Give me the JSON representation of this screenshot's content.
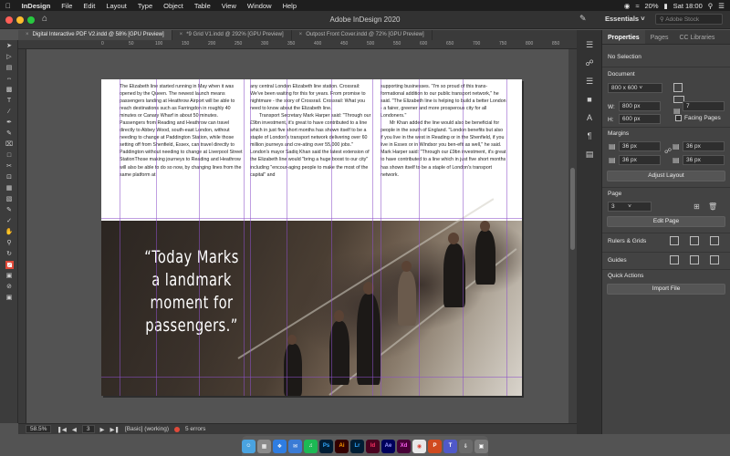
{
  "menubar": {
    "app_name": "InDesign",
    "items": [
      "File",
      "Edit",
      "Layout",
      "Type",
      "Object",
      "Table",
      "View",
      "Window",
      "Help"
    ],
    "battery": "20%",
    "clock": "Sat 18:00"
  },
  "window": {
    "title": "Adobe InDesign 2020",
    "workspace": "Essentials",
    "search_placeholder": "Adobe Stock"
  },
  "tabs": [
    {
      "label": "Digital Interactive PDF V2.indd @ 58% [GPU Preview]"
    },
    {
      "label": "*9 Grid V1.indd @ 292% [GPU Preview]"
    },
    {
      "label": "Outpost Front Cover.indd @ 72% [GPU Preview]"
    }
  ],
  "ruler": {
    "labels": [
      "0",
      "50",
      "100",
      "150",
      "200",
      "250",
      "300",
      "350",
      "400",
      "450",
      "500",
      "550",
      "600",
      "650",
      "700",
      "750",
      "800",
      "850"
    ]
  },
  "document": {
    "col1": "The Elizabeth line started running in May when it was opened by the Queen. The newest launch means passengers landing at Heathrow Airport will be able to reach destinations such as Farringdon in roughly 40 minutes or Canary Wharf in about 50 minutes. Passengers from Reading and Heathrow can travel directly to Abbey Wood, south-east London, without needing to change at Paddington Station, while those setting off from Shenfield, Essex, can travel directly to Paddington without needing to change at Liverpool Street StationThose making journeys to Reading and Heathrow will also be able to do so now, by changing lines from the same platform at",
    "col2_p1": "any central London Elizabeth line station. Crossrail: We've been waiting for this for years. From promise to nightmare - the story of Crossrail. Crossrail: What you need to know about the Elizabeth line.",
    "col2_p2": "Transport Secretary Mark Harper said: \"Through our £9bn investment, it's great to have contributed to a line which in just five short months has shown itself to be a staple of London's transport network delivering over 60 million journeys and cre-ating over 55,000 jobs.\" London's mayor Sadiq Khan said the latest extension of the Elizabeth line would \"bring a huge boost to our city\" including \"encour-aging people to make the most of the capital\" and",
    "col3_p1": "supporting businesses. \"I'm so proud of this trans-formational addition to our public transport network,\" he said. \"The Elizabeth line is helping to build a better London - a fairer, greener and more prosperous city for all Londoners.\"",
    "col3_p2": "Mr Khan added the line would also be beneficial for people in the south of England. \"London benefits but also if you live in the west in Reading or in the Shenfield, if you live in Essex or in Windsor you ben-efit as well,\" he said. Mark Harper said: \"Through our £9bn investment, it's great to have contributed to a line which in just five short months has shown itself to be a staple of London's transport network.",
    "quote": [
      "“Today Marks",
      "a landmark",
      "moment for",
      "passengers.”"
    ]
  },
  "status": {
    "zoom": "58.5%",
    "page": "3",
    "style": "[Basic] (working)",
    "errors": "5 errors"
  },
  "panel": {
    "tabs": [
      "Properties",
      "Pages",
      "CC Libraries"
    ],
    "selection": "No Selection",
    "document_label": "Document",
    "size": "800 x 600",
    "w_label": "W:",
    "w_value": "800 px",
    "h_label": "H:",
    "h_value": "600 px",
    "pages_count": "7",
    "facing_pages": "Facing Pages",
    "margins_label": "Margins",
    "margin_values": [
      "36 px",
      "36 px",
      "36 px",
      "36 px"
    ],
    "adjust_layout": "Adjust Layout",
    "page_label": "Page",
    "page_value": "3",
    "edit_page": "Edit Page",
    "rulers_grids": "Rulers & Grids",
    "guides": "Guides",
    "quick_actions": "Quick Actions",
    "import_file": "Import File"
  },
  "dock": {
    "apps": [
      "Ps",
      "Ai",
      "Lr",
      "Id",
      "Ae",
      "Xd"
    ]
  },
  "colors": {
    "accent_red": "#e04a3a",
    "guide_purple": "#8c50c8"
  }
}
